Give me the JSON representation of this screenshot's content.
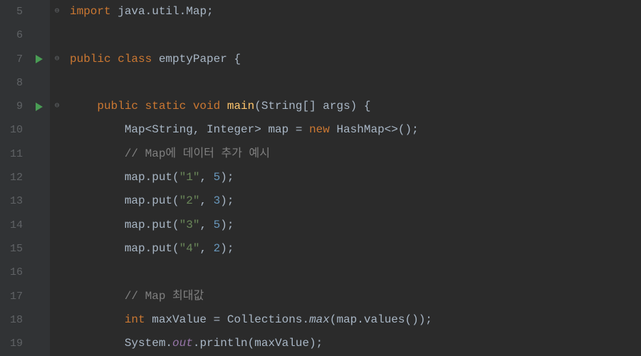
{
  "gutter": {
    "start": 5,
    "end": 19
  },
  "runMarkers": [
    7,
    9
  ],
  "foldMarkers": {
    "5": "⊖",
    "7": "⊖",
    "9": "⊖"
  },
  "lines": {
    "5": [
      {
        "t": "import ",
        "c": "kw"
      },
      {
        "t": "java.util.Map;",
        "c": "default"
      }
    ],
    "6": [],
    "7": [
      {
        "t": "public class ",
        "c": "kw"
      },
      {
        "t": "emptyPaper ",
        "c": "default"
      },
      {
        "t": "{",
        "c": "punc"
      }
    ],
    "8": [],
    "9": [
      {
        "t": "    ",
        "c": "default"
      },
      {
        "t": "public static void ",
        "c": "kw"
      },
      {
        "t": "main",
        "c": "method-decl"
      },
      {
        "t": "(String[] args) {",
        "c": "default"
      }
    ],
    "10": [
      {
        "t": "        Map<String, Integer> map = ",
        "c": "default"
      },
      {
        "t": "new ",
        "c": "kw"
      },
      {
        "t": "HashMap<>();",
        "c": "default"
      }
    ],
    "11": [
      {
        "t": "        ",
        "c": "default"
      },
      {
        "t": "// Map에 데이터 추가 예시",
        "c": "comment"
      }
    ],
    "12": [
      {
        "t": "        map.put(",
        "c": "default"
      },
      {
        "t": "\"1\"",
        "c": "string"
      },
      {
        "t": ", ",
        "c": "default"
      },
      {
        "t": "5",
        "c": "number"
      },
      {
        "t": ");",
        "c": "default"
      }
    ],
    "13": [
      {
        "t": "        map.put(",
        "c": "default"
      },
      {
        "t": "\"2\"",
        "c": "string"
      },
      {
        "t": ", ",
        "c": "default"
      },
      {
        "t": "3",
        "c": "number"
      },
      {
        "t": ");",
        "c": "default"
      }
    ],
    "14": [
      {
        "t": "        map.put(",
        "c": "default"
      },
      {
        "t": "\"3\"",
        "c": "string"
      },
      {
        "t": ", ",
        "c": "default"
      },
      {
        "t": "5",
        "c": "number"
      },
      {
        "t": ");",
        "c": "default"
      }
    ],
    "15": [
      {
        "t": "        map.put(",
        "c": "default"
      },
      {
        "t": "\"4\"",
        "c": "string"
      },
      {
        "t": ", ",
        "c": "default"
      },
      {
        "t": "2",
        "c": "number"
      },
      {
        "t": ");",
        "c": "default"
      }
    ],
    "16": [],
    "17": [
      {
        "t": "        ",
        "c": "default"
      },
      {
        "t": "// Map 최대값",
        "c": "comment"
      }
    ],
    "18": [
      {
        "t": "        ",
        "c": "default"
      },
      {
        "t": "int ",
        "c": "kw"
      },
      {
        "t": "maxValue = Collections.",
        "c": "default"
      },
      {
        "t": "max",
        "c": "static-method"
      },
      {
        "t": "(map.values());",
        "c": "default"
      }
    ],
    "19": [
      {
        "t": "        System.",
        "c": "default"
      },
      {
        "t": "out",
        "c": "static-field"
      },
      {
        "t": ".println(maxValue);",
        "c": "default"
      }
    ]
  }
}
